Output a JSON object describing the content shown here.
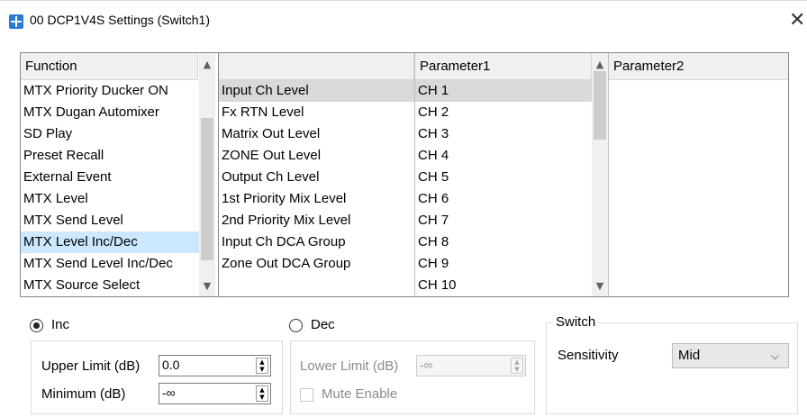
{
  "window": {
    "title": "00 DCP1V4S Settings (Switch1)",
    "close": "✕"
  },
  "function_list": {
    "header": "Function",
    "items": [
      "MTX Priority Ducker ON",
      "MTX Dugan Automixer",
      "SD Play",
      "Preset Recall",
      "External Event",
      "MTX Level",
      "MTX Send Level",
      "MTX Level Inc/Dec",
      "MTX Send Level Inc/Dec",
      "MTX Source Select"
    ],
    "selected": "MTX Level Inc/Dec"
  },
  "type_list": {
    "header": "",
    "items": [
      "Input Ch Level",
      "Fx RTN Level",
      "Matrix Out Level",
      "ZONE Out Level",
      "Output Ch Level",
      "1st Priority Mix Level",
      "2nd Priority Mix Level",
      "Input Ch DCA Group",
      "Zone Out DCA Group"
    ],
    "selected": "Input Ch Level"
  },
  "parameter1": {
    "header": "Parameter1",
    "items": [
      "CH 1",
      "CH 2",
      "CH 3",
      "CH 4",
      "CH 5",
      "CH 6",
      "CH 7",
      "CH 8",
      "CH 9",
      "CH 10"
    ],
    "selected": "CH 1"
  },
  "parameter2": {
    "header": "Parameter2",
    "items": []
  },
  "scroll_arrows": {
    "up": "▲",
    "down": "▼"
  },
  "inc": {
    "label": "Inc",
    "selected": true,
    "upper_limit_label": "Upper Limit (dB)",
    "upper_limit_value": "0.0",
    "minimum_label": "Minimum (dB)",
    "minimum_value": "-∞"
  },
  "dec": {
    "label": "Dec",
    "selected": false,
    "lower_limit_label": "Lower Limit (dB)",
    "lower_limit_value": "-∞",
    "mute_enable_label": "Mute Enable"
  },
  "switch_group": {
    "title": "Switch",
    "sensitivity_label": "Sensitivity",
    "sensitivity_value": "Mid",
    "sensitivity_arrow": "⌵"
  },
  "spin_glyph": "▲\n▼"
}
